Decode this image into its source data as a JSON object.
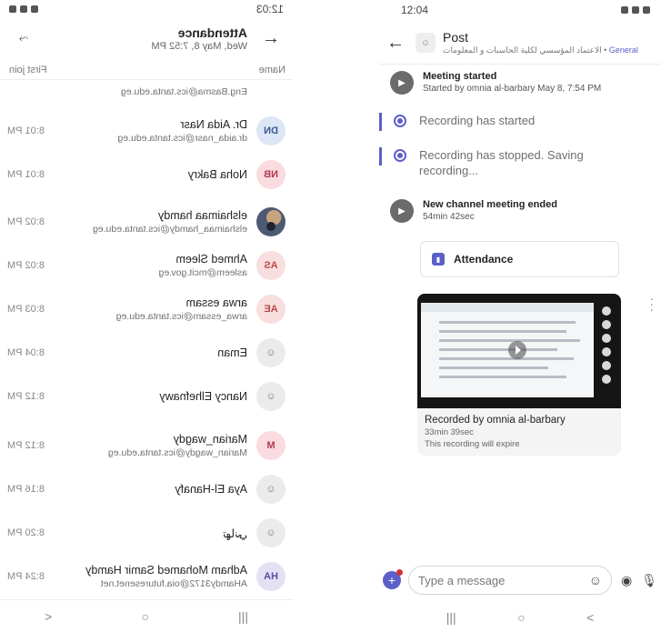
{
  "left_phone": {
    "status_time": "12:03",
    "header": {
      "title": "Attendance",
      "subtitle": "Wed, May 8, 7:52 PM"
    },
    "columns": {
      "name": "Name",
      "first_join": "First join"
    },
    "partial_row": {
      "email": "Eng.Basma@ics.tanta.edu.eg"
    },
    "attendees": [
      {
        "initials": "DN",
        "name": "Dr. Aida Nasr",
        "email": "dr.aida_nasr@ics.tanta.edu.eg",
        "time": "8:01 PM"
      },
      {
        "initials": "NB",
        "name": "Noha Bakry",
        "email": "",
        "time": "8:01 PM"
      },
      {
        "initials": "",
        "name": "elshaimaa hamdy",
        "email": "elshaimaa_hamdy@ics.tanta.edu.eg",
        "time": "8:02 PM"
      },
      {
        "initials": "AS",
        "name": "Ahmed Sleem",
        "email": "asleem@mcit.gov.eg",
        "time": "8:02 PM"
      },
      {
        "initials": "AE",
        "name": "arwa essam",
        "email": "arwa_essam@ics.tanta.edu.eg",
        "time": "8:03 PM"
      },
      {
        "initials": "",
        "name": "Eman",
        "email": "",
        "time": "8:04 PM"
      },
      {
        "initials": "",
        "name": "Nancy Elhefnawy",
        "email": "",
        "time": "8:12 PM"
      },
      {
        "initials": "M",
        "name": "Marian_wagdy",
        "email": "Marian_wagdy@ics.tanta.edu.eg",
        "time": "8:12 PM"
      },
      {
        "initials": "",
        "name": "Aya El-Hanafy",
        "email": "",
        "time": "8:16 PM"
      },
      {
        "initials": "",
        "name": "تهاني",
        "email": "",
        "time": "8:20 PM"
      },
      {
        "initials": "HA",
        "name": "Adham Mohamed Samir Hamdy",
        "email": "AHamdy3172@oia.futuresenet.net",
        "time": "8:24 PM"
      }
    ],
    "nav": {
      "back": "<",
      "home": "○",
      "recents": "|||"
    }
  },
  "right_phone": {
    "status_time": "12:04",
    "header": {
      "title": "Post",
      "channel": "General",
      "team": "الاعتماد المؤسسي لكلية الحاسبات و المعلومات"
    },
    "meeting_started": {
      "title": "Meeting started",
      "subtitle": "Started by omnia al-barbary   May 8, 7:54 PM"
    },
    "recording_started": "Recording has started",
    "recording_stopped": "Recording has stopped. Saving recording...",
    "meeting_ended": {
      "title": "New channel meeting ended",
      "duration": "54min 42sec"
    },
    "attendance_card": {
      "label": "Attendance"
    },
    "recording_card": {
      "title": "Recorded by omnia al-barbary",
      "duration": "33min 39sec",
      "note": "This recording will expire"
    },
    "composer": {
      "placeholder": "Type a message"
    },
    "nav": {
      "recents": "|||",
      "home": "○",
      "back": "<"
    },
    "colors": {
      "accent": "#5b5fc7"
    }
  }
}
